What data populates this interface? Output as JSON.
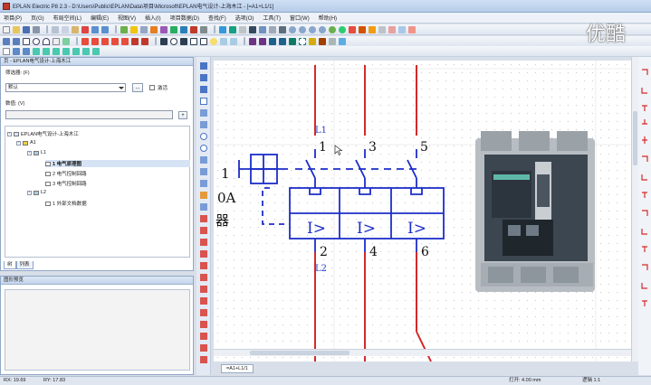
{
  "window": {
    "title": "EPLAN Electric P8 2.3 - D:\\Users\\Public\\EPLAN\\Data\\项目\\Microsoft\\EPLAN电气设计-上海木江 - [=A1+L1/1]"
  },
  "watermark": "优酷",
  "menu": [
    "项目(P)",
    "页(G)",
    "布局空间(L)",
    "编辑(E)",
    "视图(V)",
    "插入(I)",
    "项目数据(D)",
    "查找(F)",
    "选项(O)",
    "工具(T)",
    "窗口(W)",
    "帮助(H)"
  ],
  "left_panel": {
    "title": "页 - EPLAN电气设计-上海木江",
    "filter_label": "筛选器: (F)",
    "filter_value": "默认",
    "filter_btn": "...",
    "active_label": "激活",
    "value_label": "数值: (V)",
    "value_btn": "+",
    "tree": {
      "root": "EPLAN电气设计-上海木江",
      "a1": "A1",
      "l1": "L1",
      "page1": "1 电气原理图",
      "page2": "2 电气控制回路",
      "page3": "3 电气控制回路",
      "l2": "L2",
      "page4": "1 外部文档数据"
    },
    "tabs": [
      "树",
      "列表"
    ]
  },
  "graph_panel": {
    "title": "图形预览"
  },
  "canvas": {
    "terminal_top": [
      "1",
      "3",
      "5"
    ],
    "terminal_bottom": [
      "2",
      "4",
      "6"
    ],
    "label_l1": "L1",
    "label_l2": "L2",
    "relay_symbol": "I>",
    "left_partial": [
      "1",
      "0A",
      "器"
    ]
  },
  "page_tab": "=A1+L1/1",
  "status": {
    "rx": "RX: 19.69",
    "ry": "RY: 17.83",
    "grid": "打开: 4.00 mm",
    "logic": "逻辑 1:1"
  },
  "colors": {
    "wire_red": "#d42a2a",
    "symbol_blue": "#1c2ec8",
    "label_blue": "#2a3fd0"
  }
}
